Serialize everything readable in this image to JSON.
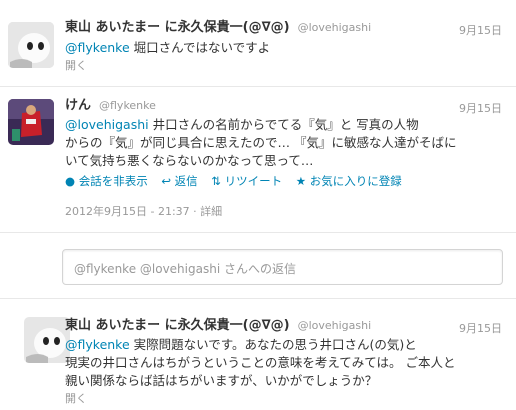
{
  "tweet1": {
    "name": "東山 あいたまー に永久保貴一(@∇@)",
    "handle": "@lovehigashi",
    "date": "9月15日",
    "mention": "@flykenke",
    "text": " 堀口さんではないですよ",
    "expand": "開く"
  },
  "tweet2": {
    "name": "けん",
    "handle": "@flykenke",
    "date": "9月15日",
    "lines": [
      {
        "mention": "@lovehigashi",
        "text": " 井口さんの名前からでてる『気』と 写真の人物"
      },
      {
        "mention": "",
        "text": "からの『気』が同じ具合に思えたので… 『気』に敏感な人達がそばに"
      },
      {
        "mention": "",
        "text": "いて気持ち悪くならないのかなって思って…"
      }
    ],
    "actions": {
      "hide": "会話を非表示",
      "reply": "返信",
      "retweet": "リツイート",
      "favorite": "お気に入りに登録"
    },
    "timestamp": "2012年9月15日 - 21:37",
    "details": "詳細"
  },
  "reply_box": {
    "placeholder": "@flykenke @lovehigashi さんへの返信"
  },
  "tweet3": {
    "name": "東山 あいたまー に永久保貴一(@∇@)",
    "handle": "@lovehigashi",
    "date": "9月15日",
    "lines": [
      {
        "mention": "@flykenke",
        "text": " 実際問題ないです。あなたの思う井口さん(の気)と"
      },
      {
        "mention": "",
        "text": "現実の井口さんはちがうということの意味を考えてみては。 ご本人と"
      },
      {
        "mention": "",
        "text": "親い関係ならば話はちがいますが、いかがでしょうか？"
      }
    ],
    "expand": "開く"
  }
}
